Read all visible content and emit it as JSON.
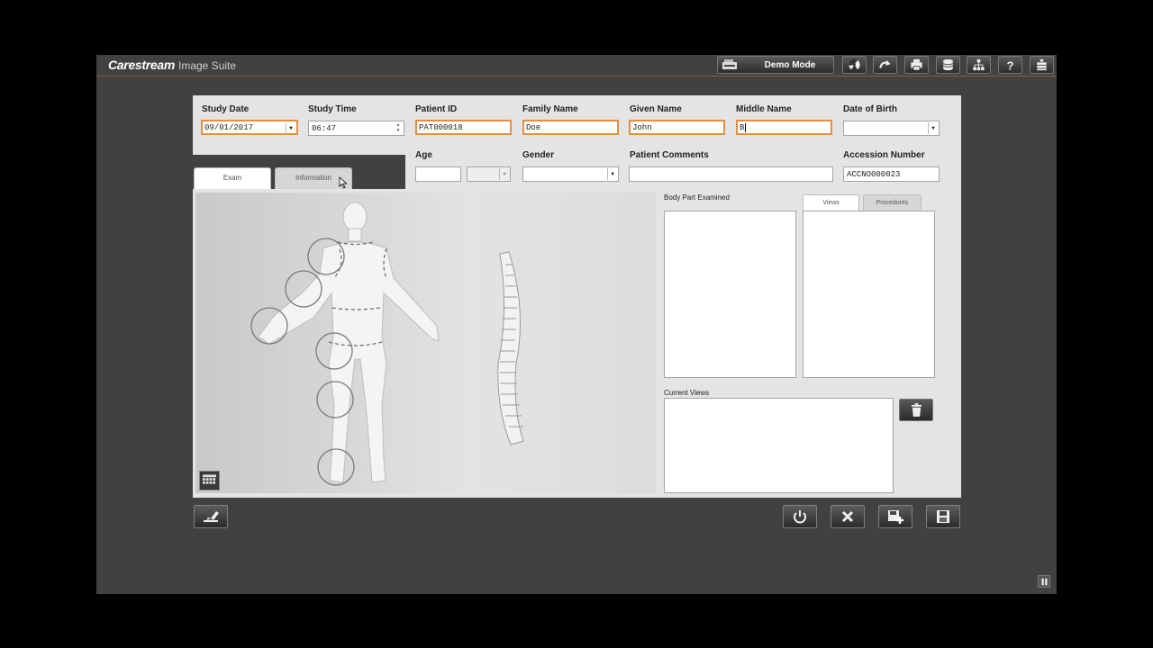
{
  "header": {
    "brand": "Carestream",
    "brand_sub": "Image Suite",
    "demo_mode": "Demo Mode",
    "toolbar_icons": [
      "radiation-icon",
      "redo-icon",
      "printer-icon",
      "database-icon",
      "network-icon",
      "help-icon",
      "menu-icon"
    ]
  },
  "form": {
    "study_date": {
      "label": "Study Date",
      "value": "09/01/2017"
    },
    "study_time": {
      "label": "Study Time",
      "value": "06:47"
    },
    "patient_id": {
      "label": "Patient ID",
      "value": "PAT000018"
    },
    "family_name": {
      "label": "Family Name",
      "value": "Doe"
    },
    "given_name": {
      "label": "Given Name",
      "value": "John"
    },
    "middle_name": {
      "label": "Middle Name",
      "value": "B"
    },
    "date_of_birth": {
      "label": "Date of Birth",
      "value": ""
    },
    "age": {
      "label": "Age",
      "value": "",
      "unit": ""
    },
    "gender": {
      "label": "Gender",
      "value": ""
    },
    "patient_comments": {
      "label": "Patient Comments",
      "value": ""
    },
    "accession_number": {
      "label": "Accession Number",
      "value": "ACCNO000023"
    }
  },
  "tabs": {
    "exam": "Exam",
    "information": "Information"
  },
  "right_panel": {
    "body_part_label": "Body Part Examined",
    "views_tab": "Views",
    "procedures_tab": "Procedures",
    "current_views_label": "Current Views"
  },
  "colors": {
    "app_bg": "#414141",
    "panel_bg": "#e4e4e4",
    "highlight": "#e58e42"
  }
}
